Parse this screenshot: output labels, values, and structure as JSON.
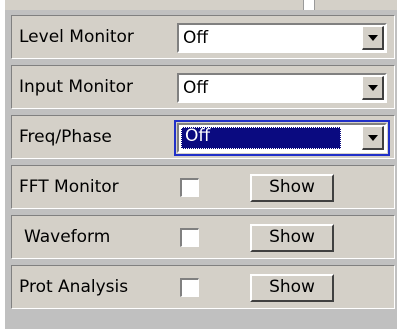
{
  "rows": [
    {
      "label": "Level Monitor",
      "control": "dropdown",
      "value": "Off"
    },
    {
      "label": "Input Monitor",
      "control": "dropdown",
      "value": "Off"
    },
    {
      "label": "Freq/Phase",
      "control": "dropdown",
      "value": "Off",
      "focused": true
    },
    {
      "label": "FFT Monitor",
      "control": "checkbox",
      "checked": false,
      "button_label": "Show"
    },
    {
      "label": "Waveform",
      "control": "checkbox",
      "checked": false,
      "button_label": "Show"
    },
    {
      "label": "Prot Analysis",
      "control": "checkbox",
      "checked": false,
      "button_label": "Show"
    }
  ],
  "colors": {
    "panel": "#d4d0c8",
    "selection": "#0a0a80",
    "focus_ring": "#2030c8"
  }
}
